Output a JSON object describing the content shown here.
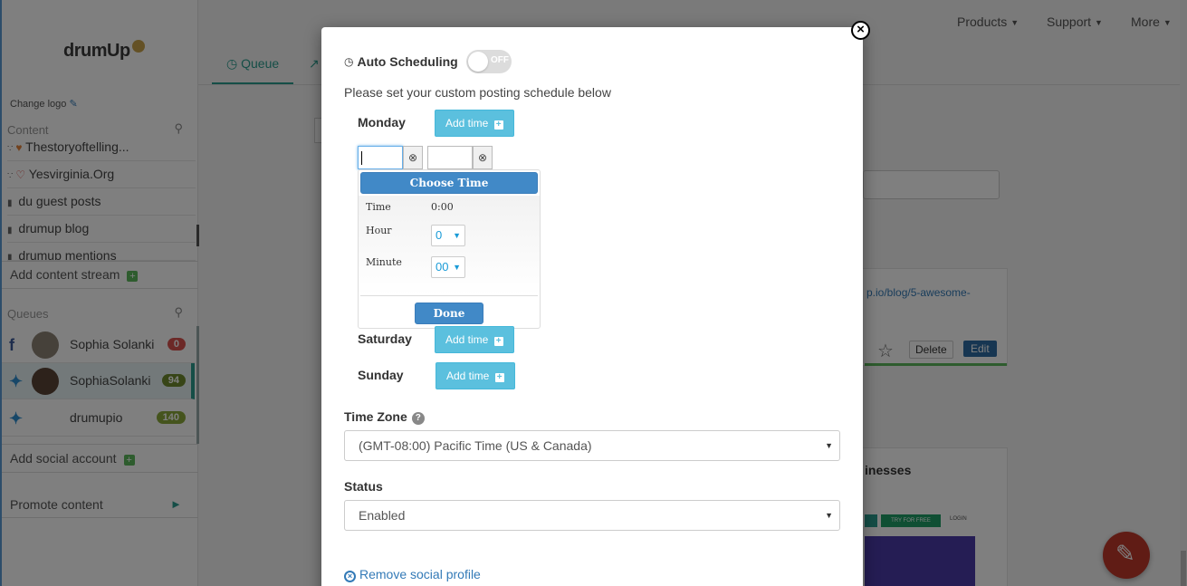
{
  "nav": {
    "products": "Products",
    "support": "Support",
    "more": "More"
  },
  "sidebar": {
    "logo": "drumUp",
    "change_logo": "Change logo",
    "content_header": "Content",
    "streams": [
      {
        "label": "Thestoryoftelling..."
      },
      {
        "label": "Yesvirginia.Org"
      },
      {
        "label": "du guest posts"
      },
      {
        "label": "drumup blog"
      },
      {
        "label": "drumup mentions"
      }
    ],
    "add_content_stream": "Add content stream",
    "queues_header": "Queues",
    "queues": [
      {
        "network": "facebook",
        "name": "Sophia Solanki",
        "count": "0"
      },
      {
        "network": "twitter",
        "name": "SophiaSolanki",
        "count": "94"
      },
      {
        "network": "twitter",
        "name": "drumupio",
        "count": "140"
      }
    ],
    "add_social_account": "Add social account",
    "promote_content": "Promote content"
  },
  "main": {
    "tab_queue": "Queue",
    "link_snippet": "p.io/blog/5-awesome-",
    "delete_label": "Delete",
    "edit_label": "Edit",
    "card_title": "inesses",
    "thumb_cta": "TRY FOR FREE",
    "thumb_login": "LOGIN"
  },
  "modal": {
    "auto_scheduling_label": "Auto Scheduling",
    "toggle_state": "OFF",
    "instructions": "Please set your custom posting schedule below",
    "days": [
      {
        "day": "Monday",
        "button": "Add time"
      },
      {
        "day": "Saturday",
        "button": "Add time"
      },
      {
        "day": "Sunday",
        "button": "Add time"
      }
    ],
    "time_picker": {
      "header": "Choose Time",
      "time_label": "Time",
      "time_value": "0:00",
      "hour_label": "Hour",
      "hour_value": "0",
      "minute_label": "Minute",
      "minute_value": "00",
      "done_label": "Done"
    },
    "time_zone_label": "Time Zone",
    "time_zone_value": "(GMT-08:00) Pacific Time (US & Canada)",
    "status_label": "Status",
    "status_value": "Enabled",
    "remove_profile": "Remove social profile"
  },
  "colors": {
    "accent": "#2a9d8f",
    "info_button": "#5bc0de",
    "picker_blue": "#4189c7",
    "link": "#337ab7"
  }
}
